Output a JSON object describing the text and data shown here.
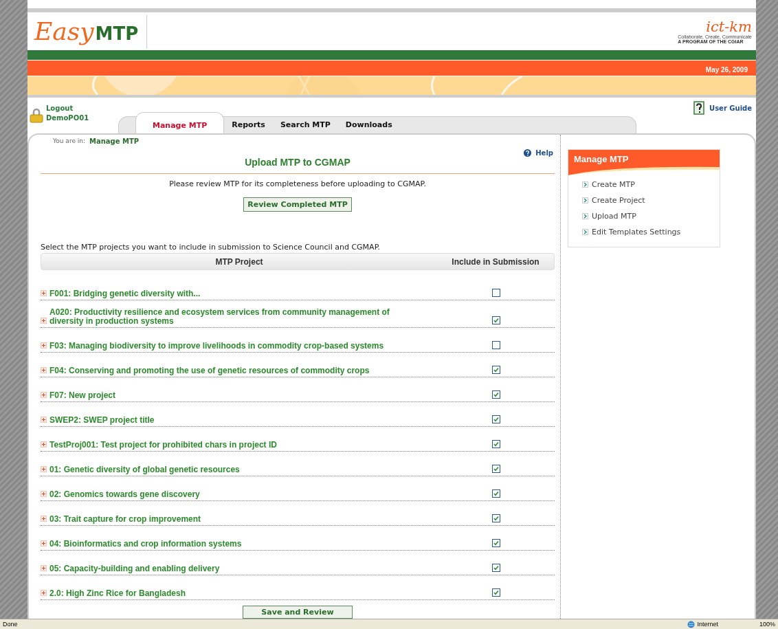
{
  "logo": {
    "easy": "Easy",
    "mtp": "MTP"
  },
  "partner_logo": {
    "name": "ict-km",
    "tagline": "Collaborate, Create, Communicate",
    "program": "A PROGRAM OF THE CGIAR"
  },
  "date": "May 26, 2009",
  "user": {
    "logout": "Logout",
    "username": "DemoPO01"
  },
  "user_guide": "User Guide",
  "tabs": [
    {
      "label": "Manage MTP",
      "selected": true
    },
    {
      "label": "Reports",
      "selected": false
    },
    {
      "label": "Search MTP",
      "selected": false
    },
    {
      "label": "Downloads",
      "selected": false
    }
  ],
  "breadcrumb": {
    "label": "You are in:",
    "location": "Manage MTP"
  },
  "help": "Help",
  "page_title": "Upload MTP to CGMAP",
  "review_note": "Please review MTP for its completeness before uploading to CGMAP.",
  "review_button": "Review Completed MTP",
  "instruction": "Select the MTP projects you want to include in submission to Science Council and CGMAP.",
  "table": {
    "columns": [
      "MTP Project",
      "Include in Submission"
    ],
    "rows": [
      {
        "project": "F001: Bridging genetic diversity with...",
        "checked": false
      },
      {
        "project": "A020: Productivity resilience and ecosystem services from community management of diversity in production systems",
        "checked": true
      },
      {
        "project": "F03: Managing biodiversity to improve livelihoods in commodity crop-based systems",
        "checked": false
      },
      {
        "project": "F04: Conserving and promoting the use of genetic resources of commodity crops",
        "checked": true
      },
      {
        "project": "F07: New project",
        "checked": true
      },
      {
        "project": "SWEP2: SWEP project title",
        "checked": true
      },
      {
        "project": "TestProj001: Test project for prohibited chars in project ID",
        "checked": true
      },
      {
        "project": "01: Genetic diversity of global genetic resources",
        "checked": true
      },
      {
        "project": "02: Genomics towards gene discovery",
        "checked": true
      },
      {
        "project": "03: Trait capture for crop improvement",
        "checked": true
      },
      {
        "project": "04: Bioinformatics and crop information systems",
        "checked": true
      },
      {
        "project": "05: Capacity-building and enabling delivery",
        "checked": true
      },
      {
        "project": "2.0: High Zinc Rice for Bangladesh",
        "checked": true
      }
    ]
  },
  "save_button": "Save and Review",
  "sidebar": {
    "title": "Manage MTP",
    "items": [
      "Create MTP",
      "Create Project",
      "Upload MTP",
      "Edit Templates Settings"
    ]
  },
  "status_bar": {
    "status": "Done",
    "zone": "Internet",
    "zoom": "100%"
  }
}
